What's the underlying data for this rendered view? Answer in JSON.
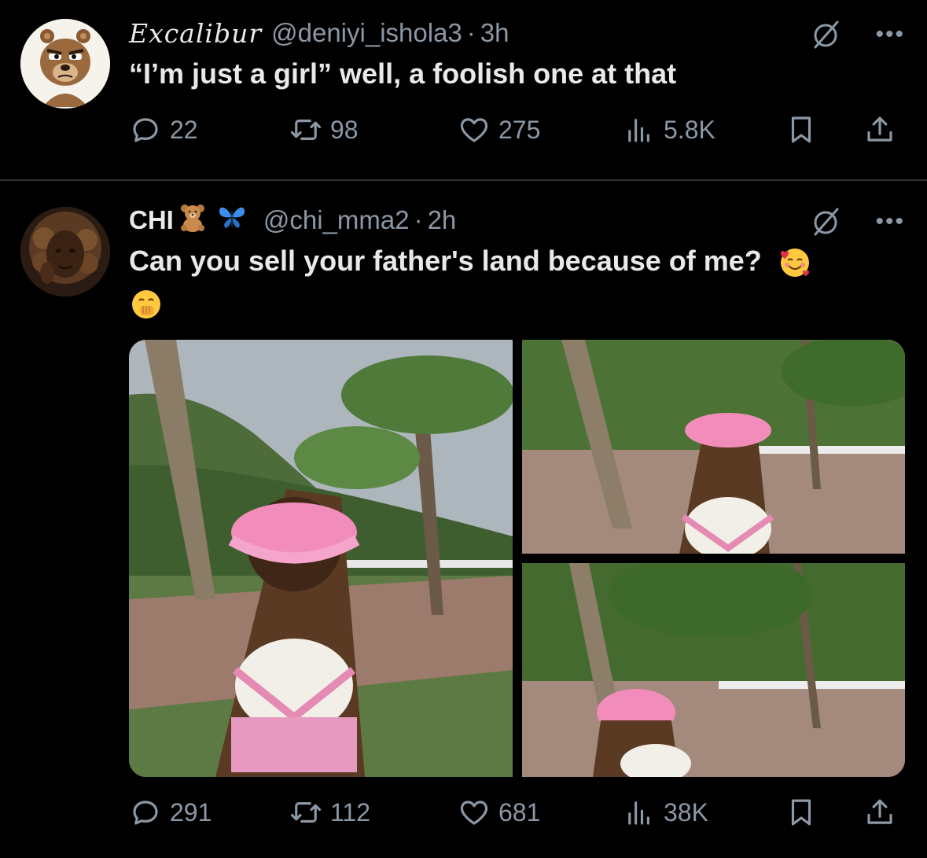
{
  "tweets": [
    {
      "display_name": "Excalibur",
      "handle": "@deniyi_ishola3",
      "separator": "·",
      "time": "3h",
      "text": "“I’m just a girl” well, a foolish one at that",
      "stats": {
        "replies": "22",
        "retweets": "98",
        "likes": "275",
        "views": "5.8K"
      }
    },
    {
      "display_name": "CHI",
      "name_emojis": [
        "🧸",
        "🦋"
      ],
      "handle": "@chi_mma2",
      "separator": "·",
      "time": "2h",
      "text": "Can you sell your father's land because of me?",
      "text_emojis": [
        "🥰",
        "🤭"
      ],
      "stats": {
        "replies": "291",
        "retweets": "112",
        "likes": "681",
        "views": "38K"
      }
    }
  ],
  "icons": {
    "reply": "reply-icon",
    "retweet": "retweet-icon",
    "like": "heart-icon",
    "views": "views-icon",
    "bookmark": "bookmark-icon",
    "share": "share-icon",
    "grok": "grok-icon",
    "more": "more-icon"
  },
  "colors": {
    "background": "#000000",
    "text": "#e7e9ea",
    "muted": "#8b98a5",
    "divider": "#2f3336"
  }
}
